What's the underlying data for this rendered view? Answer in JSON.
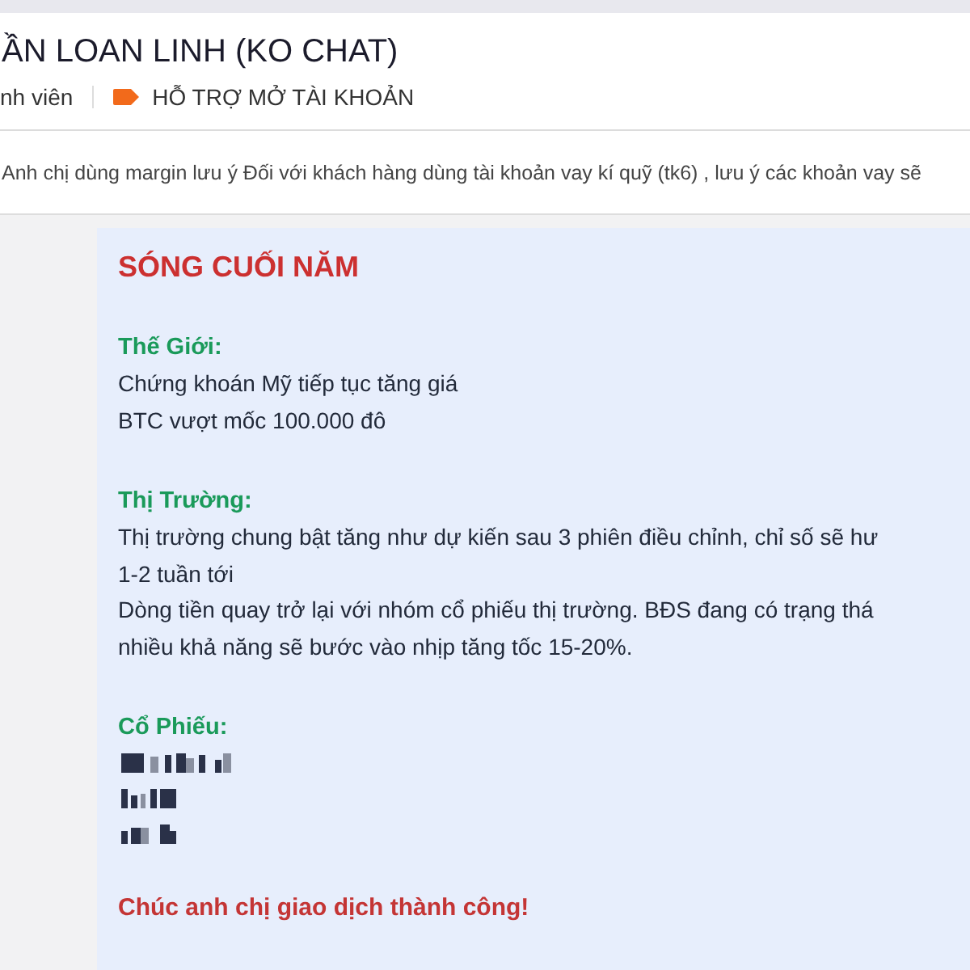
{
  "header": {
    "title": "ẦN LOAN LINH (KO CHAT)",
    "subtitle": "nh viên",
    "tag": "HỖ TRỢ MỞ TÀI KHOẢN"
  },
  "pinned": "Anh chị dùng margin lưu ý  Đối với khách hàng dùng tài khoản vay kí quỹ (tk6) , lưu ý các khoản vay sẽ",
  "message": {
    "title": "SÓNG CUỐI NĂM",
    "sections": [
      {
        "kind": "text",
        "heading": "Thế Giới:",
        "lines": [
          "Chứng khoán Mỹ tiếp tục tăng giá",
          "BTC vượt mốc 100.000 đô"
        ]
      },
      {
        "kind": "text",
        "heading": "Thị Trường:",
        "lines": [
          "Thị trường chung bật tăng như dự kiến sau 3 phiên điều chỉnh, chỉ số sẽ hư",
          "1-2 tuần tới",
          "Dòng tiền quay trở lại với nhóm cổ phiếu thị trường. BĐS đang có trạng thá",
          "nhiều khả năng sẽ bước vào nhịp tăng tốc 15-20%."
        ]
      },
      {
        "kind": "redacted",
        "heading": "Cổ Phiếu:"
      }
    ],
    "closing": "Chúc anh chị giao dịch thành công!"
  }
}
